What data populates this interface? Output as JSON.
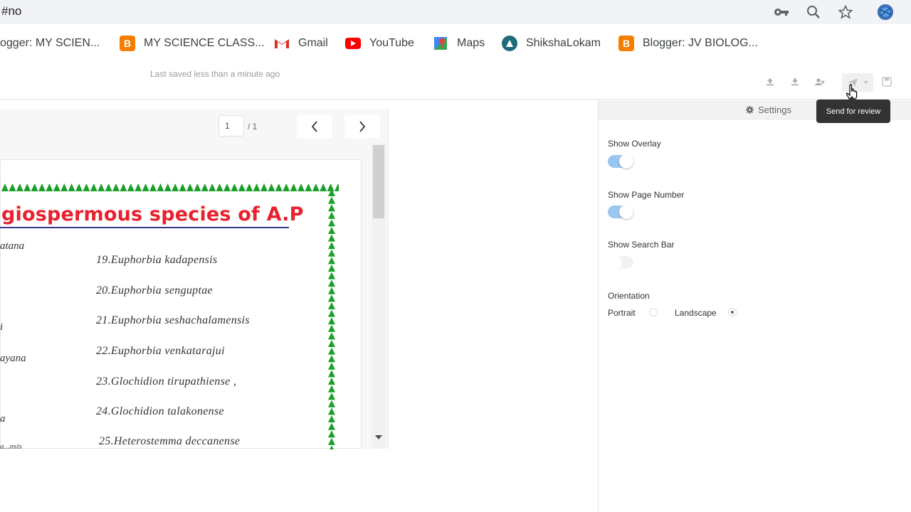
{
  "browser": {
    "url": "#no",
    "icons": [
      "key-icon",
      "zoom-icon",
      "star-icon",
      "profile-avatar"
    ]
  },
  "bookmarks": [
    {
      "label": "ogger: MY SCIEN...",
      "icon": "blogger-icon"
    },
    {
      "label": "MY SCIENCE CLASS...",
      "icon": "blogger-icon"
    },
    {
      "label": "Gmail",
      "icon": "gmail-icon"
    },
    {
      "label": "YouTube",
      "icon": "youtube-icon"
    },
    {
      "label": "Maps",
      "icon": "maps-icon"
    },
    {
      "label": "ShikshaLokam",
      "icon": "shikshalokam-icon"
    },
    {
      "label": "Blogger: JV BIOLOG...",
      "icon": "blogger-icon"
    }
  ],
  "app": {
    "saved_status": "Last saved less than a minute ago",
    "tooltip": "Send for review"
  },
  "viewer": {
    "page_current": "1",
    "page_total": "/ 1",
    "doc_title": "giospermous species of A.P",
    "left_fragments": [
      "atana",
      "i",
      "ayana",
      "a",
      "a...nsis"
    ],
    "species": [
      "19.Euphorbia kadapensis",
      "20.Euphorbia senguptae",
      "21.Euphorbia seshachalamensis",
      "22.Euphorbia venkatarajui",
      "23.Glochidion tirupathiense ,",
      "24.Glochidion talakonense",
      "25.Heterostemma deccanense"
    ]
  },
  "panel": {
    "settings_label": "Settings",
    "show_overlay": {
      "label": "Show Overlay",
      "on": true
    },
    "show_page_number": {
      "label": "Show Page Number",
      "on": true
    },
    "show_search_bar": {
      "label": "Show Search Bar",
      "on": false
    },
    "orientation": {
      "label": "Orientation",
      "portrait": "Portrait",
      "landscape": "Landscape",
      "selected": "Landscape"
    }
  },
  "colors": {
    "title_red": "#e8212d",
    "border_green": "#1aa02a",
    "toggle_on": "#9ac6ef"
  }
}
